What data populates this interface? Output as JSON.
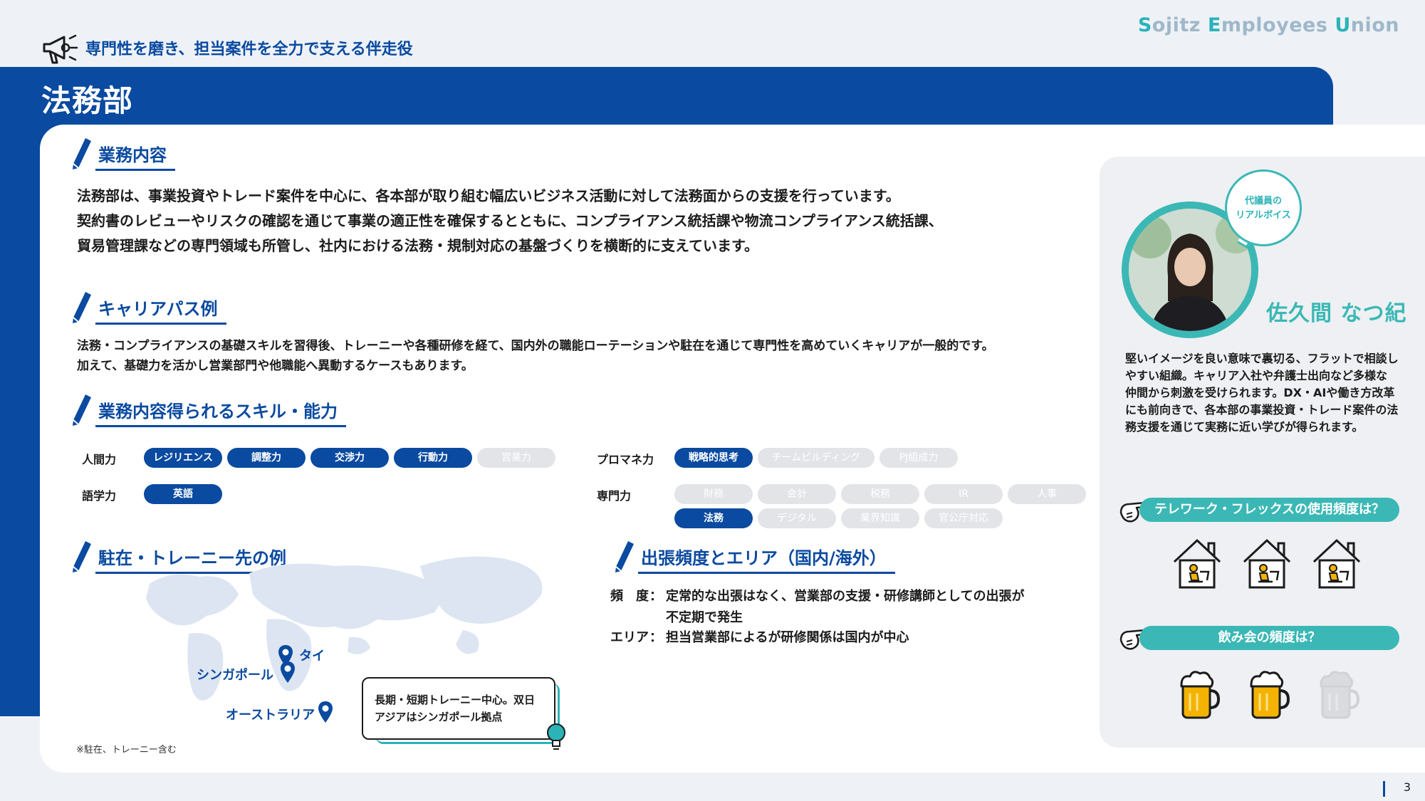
{
  "header": {
    "logo": [
      {
        "text": "S",
        "hl": true
      },
      {
        "text": "ojitz ",
        "hl": false
      },
      {
        "text": "E",
        "hl": true
      },
      {
        "text": "mployees ",
        "hl": false
      },
      {
        "text": "U",
        "hl": true
      },
      {
        "text": "nion",
        "hl": false
      }
    ],
    "tagline": "専門性を磨き、担当案件を全力で支える伴走役",
    "department": "法務部"
  },
  "sections": {
    "work": {
      "title": "業務内容",
      "lines": [
        "法務部は、事業投資やトレード案件を中心に、各本部が取り組む幅広いビジネス活動に対して法務面からの支援を行っています。",
        "契約書のレビューやリスクの確認を通じて事業の適正性を確保するとともに、コンプライアンス統括課や物流コンプライアンス統括課、",
        "貿易管理課などの専門領域も所管し、社内における法務・規制対応の基盤づくりを横断的に支えています。"
      ]
    },
    "career": {
      "title": "キャリアパス例",
      "lines": [
        "法務・コンプライアンスの基礎スキルを習得後、トレーニーや各種研修を経て、国内外の職能ローテーションや駐在を通じて専門性を高めていくキャリアが一般的です。",
        "加えて、基礎力を活かし営業部門や他職能へ異動するケースもあります。"
      ]
    },
    "skills": {
      "title": "業務内容得られるスキル・能力",
      "groups": [
        {
          "label": "人間力",
          "pills": [
            {
              "text": "レジリエンス",
              "on": true
            },
            {
              "text": "調整力",
              "on": true
            },
            {
              "text": "交渉力",
              "on": true
            },
            {
              "text": "行動力",
              "on": true
            },
            {
              "text": "営業力",
              "on": false
            }
          ]
        },
        {
          "label": "語学力",
          "pills": [
            {
              "text": "英語",
              "on": true
            }
          ]
        },
        {
          "label": "プロマネ力",
          "pills": [
            {
              "text": "戦略的思考",
              "on": true
            },
            {
              "text": "チームビルディング",
              "on": false
            },
            {
              "text": "PJ組成力",
              "on": false
            }
          ]
        },
        {
          "label": "専門力",
          "pills": [
            {
              "text": "財務",
              "on": false
            },
            {
              "text": "会計",
              "on": false
            },
            {
              "text": "税務",
              "on": false
            },
            {
              "text": "IR",
              "on": false
            },
            {
              "text": "人事",
              "on": false
            },
            {
              "text": "法務",
              "on": true
            },
            {
              "text": "デジタル",
              "on": false
            },
            {
              "text": "業界知識",
              "on": false
            },
            {
              "text": "官公庁対応",
              "on": false
            }
          ]
        }
      ]
    },
    "postings": {
      "title": "駐在・トレーニー先の例",
      "cities": [
        "タイ",
        "シンガポール",
        "オーストラリア"
      ],
      "callout": [
        "長期・短期トレーニー中心。双日",
        "アジアはシンガポール拠点"
      ],
      "note": "※駐在、トレーニー含む"
    },
    "travel": {
      "title": "出張頻度とエリア（国内/海外）",
      "freq_label": "頻　度",
      "freq_sep": "：",
      "freq_lines": [
        "定常的な出張はなく、営業部の支援・研修講師としての出張が",
        "不定期で発生"
      ],
      "area_label": "エリア",
      "area_sep": "：",
      "area_text": "担当営業部によるが研修関係は国内が中心"
    }
  },
  "voice": {
    "bubble": [
      "代議員の",
      "リアルボイス"
    ],
    "name": "佐久間 なつ紀",
    "lines": [
      "堅いイメージを良い意味で裏切る、フラットで相談し",
      "やすい組織。キャリア入社や弁護士出向など多様な",
      "仲間から刺激を受けられます。DX・AIや働き方改革",
      "にも前向きで、各本部の事業投資・トレード案件の法",
      "務支援を通じて実務に近い学びが得られます。"
    ],
    "telework_question": "テレワーク・フレックスの使用頻度は？",
    "telework_level": 3,
    "telework_max": 3,
    "drinking_question": "飲み会の頻度は？",
    "drinking_level": 2,
    "drinking_max": 3
  },
  "colors": {
    "brand": "#0a4aa0",
    "accent": "#3bb8b5",
    "inactive": "#e2e4e8"
  },
  "page_number": "3"
}
